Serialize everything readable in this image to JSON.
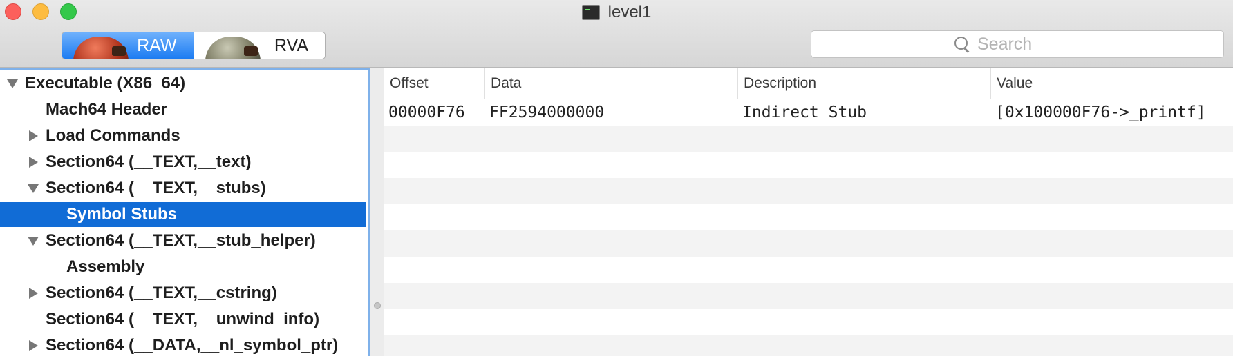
{
  "window": {
    "title": "level1"
  },
  "view_mode": {
    "options": [
      "RAW",
      "RVA"
    ],
    "selected": "RAW"
  },
  "search": {
    "placeholder": "Search",
    "value": ""
  },
  "sidebar": {
    "items": [
      {
        "label": "Executable  (X86_64)",
        "indent": 0,
        "disclosure": "down"
      },
      {
        "label": "Mach64 Header",
        "indent": 1,
        "disclosure": "none"
      },
      {
        "label": "Load Commands",
        "indent": 1,
        "disclosure": "right"
      },
      {
        "label": "Section64 (__TEXT,__text)",
        "indent": 1,
        "disclosure": "right"
      },
      {
        "label": "Section64 (__TEXT,__stubs)",
        "indent": 1,
        "disclosure": "down"
      },
      {
        "label": "Symbol Stubs",
        "indent": 2,
        "disclosure": "none",
        "selected": true
      },
      {
        "label": "Section64 (__TEXT,__stub_helper)",
        "indent": 1,
        "disclosure": "down"
      },
      {
        "label": "Assembly",
        "indent": 2,
        "disclosure": "none"
      },
      {
        "label": "Section64 (__TEXT,__cstring)",
        "indent": 1,
        "disclosure": "right"
      },
      {
        "label": "Section64 (__TEXT,__unwind_info)",
        "indent": 1,
        "disclosure": "none"
      },
      {
        "label": "Section64 (__DATA,__nl_symbol_ptr)",
        "indent": 1,
        "disclosure": "right"
      }
    ]
  },
  "table": {
    "columns": [
      "Offset",
      "Data",
      "Description",
      "Value"
    ],
    "rows": [
      [
        "00000F76",
        "FF2594000000",
        "Indirect Stub",
        "[0x100000F76->_printf]"
      ]
    ]
  },
  "colors": {
    "selection": "#116cd6",
    "segment_active": "#1c7cf2",
    "sidebar_border": "#7fb1ea"
  }
}
